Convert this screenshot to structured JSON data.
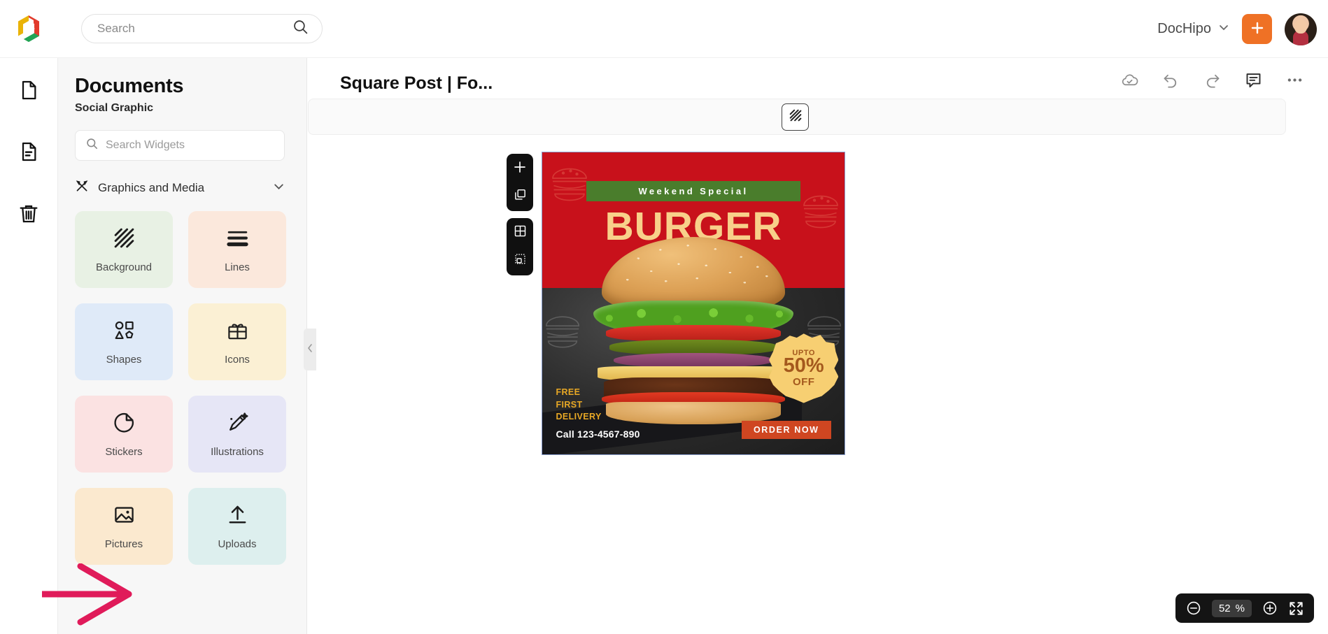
{
  "app": {
    "logo_name": "dochipo-logo"
  },
  "topbar": {
    "search": {
      "value": "",
      "placeholder": "Search",
      "icon": "search-icon"
    },
    "account": {
      "name": "DocHipo",
      "chevron": "chevron-down-icon"
    },
    "create_button": {
      "icon": "plus-icon",
      "color": "#ef7125"
    },
    "avatar": "user-avatar"
  },
  "rail": {
    "items": [
      {
        "name": "blank-page",
        "icon": "page-icon",
        "active": false
      },
      {
        "name": "documents",
        "icon": "document-lines-icon",
        "active": true
      },
      {
        "name": "trash",
        "icon": "trash-icon",
        "active": false
      }
    ]
  },
  "panel": {
    "title": "Documents",
    "subtitle": "Social Graphic",
    "search": {
      "value": "",
      "placeholder": "Search Widgets",
      "icon": "search-icon"
    },
    "section": {
      "label": "Graphics and Media",
      "icon": "tools-icon",
      "chevron": "chevron-down-icon",
      "expanded": true
    },
    "widgets": [
      {
        "label": "Background",
        "icon": "hatch-pattern-icon",
        "bg": "#e8f1e4"
      },
      {
        "label": "Lines",
        "icon": "lines-icon",
        "bg": "#fbe8dc"
      },
      {
        "label": "Shapes",
        "icon": "shapes-icon",
        "bg": "#dfeaf8"
      },
      {
        "label": "Icons",
        "icon": "gift-icon",
        "bg": "#fbf0d4"
      },
      {
        "label": "Stickers",
        "icon": "sticker-icon",
        "bg": "#fbe2e2"
      },
      {
        "label": "Illustrations",
        "icon": "pen-sparkle-icon",
        "bg": "#e6e6f6"
      },
      {
        "label": "Pictures",
        "icon": "image-icon",
        "bg": "#fbe9cf"
      },
      {
        "label": "Uploads",
        "icon": "upload-icon",
        "bg": "#ddefee"
      }
    ],
    "collapse": {
      "icon": "chevron-left-icon"
    }
  },
  "canvas": {
    "doc_title": "Square Post | Fo...",
    "actions": [
      {
        "name": "cloud-saved",
        "icon": "cloud-check-icon"
      },
      {
        "name": "undo",
        "icon": "undo-icon"
      },
      {
        "name": "redo",
        "icon": "redo-icon"
      },
      {
        "name": "comments",
        "icon": "comment-icon"
      },
      {
        "name": "more",
        "icon": "more-horizontal-icon"
      }
    ],
    "context_toolbar": {
      "button_icon": "hatch-pattern-icon"
    },
    "page_tools": [
      {
        "name": "add-page",
        "icon": "plus-icon"
      },
      {
        "name": "duplicate-page",
        "icon": "copy-icon"
      },
      {
        "name": "grid-view",
        "icon": "grid-icon"
      },
      {
        "name": "select-area",
        "icon": "dotted-select-icon"
      }
    ],
    "zoom": {
      "level": "52",
      "unit": "%",
      "out_icon": "minus-circle-icon",
      "in_icon": "plus-circle-icon",
      "fit_icon": "expand-icon"
    }
  },
  "design": {
    "badge_text": "Weekend Special",
    "headline": "BURGER",
    "offer": {
      "upto": "UPTO",
      "percent": "50%",
      "off": "OFF"
    },
    "delivery_lines": [
      "FREE",
      "FIRST",
      "DELIVERY"
    ],
    "call_text": "Call 123-4567-890",
    "cta_label": "ORDER NOW",
    "colors": {
      "background_red": "#c8111b",
      "badge_green": "#4a7d2c",
      "headline_cream": "#f8d08a",
      "offer_yellow": "#f7cf72",
      "cta_orange": "#cf4621",
      "delivery_gold": "#e8a825"
    }
  },
  "annotation": {
    "arrow_color": "#e01b5a",
    "points_to": "Pictures"
  }
}
